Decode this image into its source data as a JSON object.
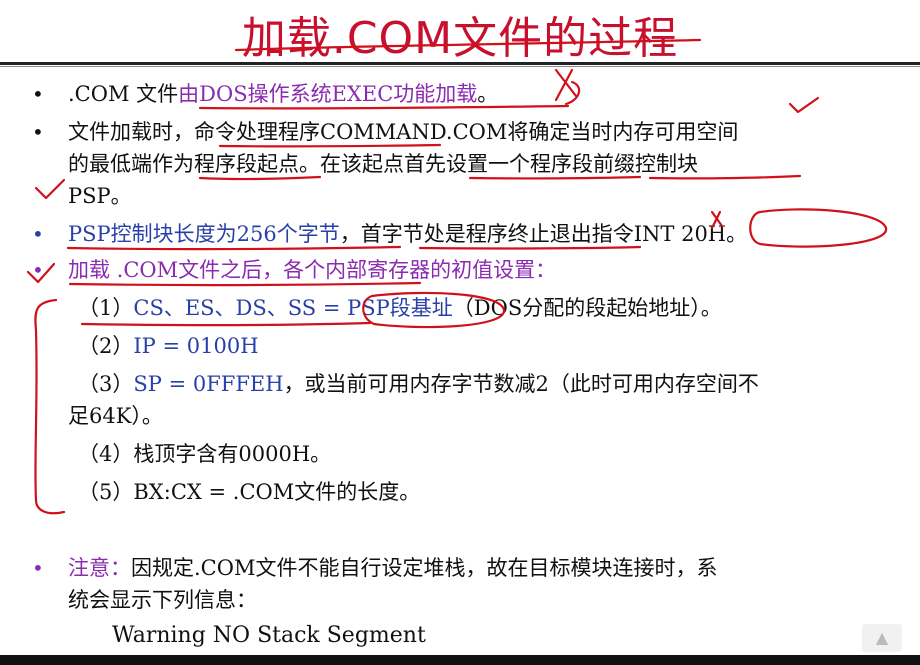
{
  "title": "加载.COM文件的过程",
  "bullets": [
    {
      "pre": ".COM 文件",
      "highlight": "由DOS操作系统EXEC功能加载",
      "post": "。"
    },
    {
      "line1": "文件加载时，命令处理程序COMMAND.COM将确定当时内存可用空间",
      "line2": "的最低端作为程序段起点。在该起点首先设置一个程序段前缀控制块",
      "line3": "PSP。"
    },
    {
      "highlight": "PSP控制块长度为256个字节",
      "post": "，首字节处是程序终止退出指令INT 20H。"
    },
    {
      "text": "加载 .COM文件之后，各个内部寄存器的初值设置："
    }
  ],
  "items": [
    {
      "num": "（1）",
      "blue": "CS、ES、DS、SS = PSP段基址",
      "rest": "（DOS分配的段起始地址）。"
    },
    {
      "num": "（2）",
      "blue": "IP = 0100H",
      "rest": ""
    },
    {
      "num": "（3）",
      "blue": "SP = 0FFFEH",
      "rest": "，或当前可用内存字节数减2（此时可用内存空间不"
    },
    {
      "cont": "足64K）。"
    },
    {
      "num": "（4）",
      "text": "栈顶字含有0000H。"
    },
    {
      "num": "（5）",
      "text": "BX:CX = .COM文件的长度。"
    }
  ],
  "note": {
    "label": "注意：",
    "line1": "因规定.COM文件不能自行设定堆栈，故在目标模块连接时，系",
    "line2": "统会显示下列信息：",
    "warning": "Warning NO Stack Segment"
  },
  "colors": {
    "title": "#c8102e",
    "purple": "#8a2bb0",
    "blue": "#2840a8",
    "ink": "#d0101a"
  }
}
